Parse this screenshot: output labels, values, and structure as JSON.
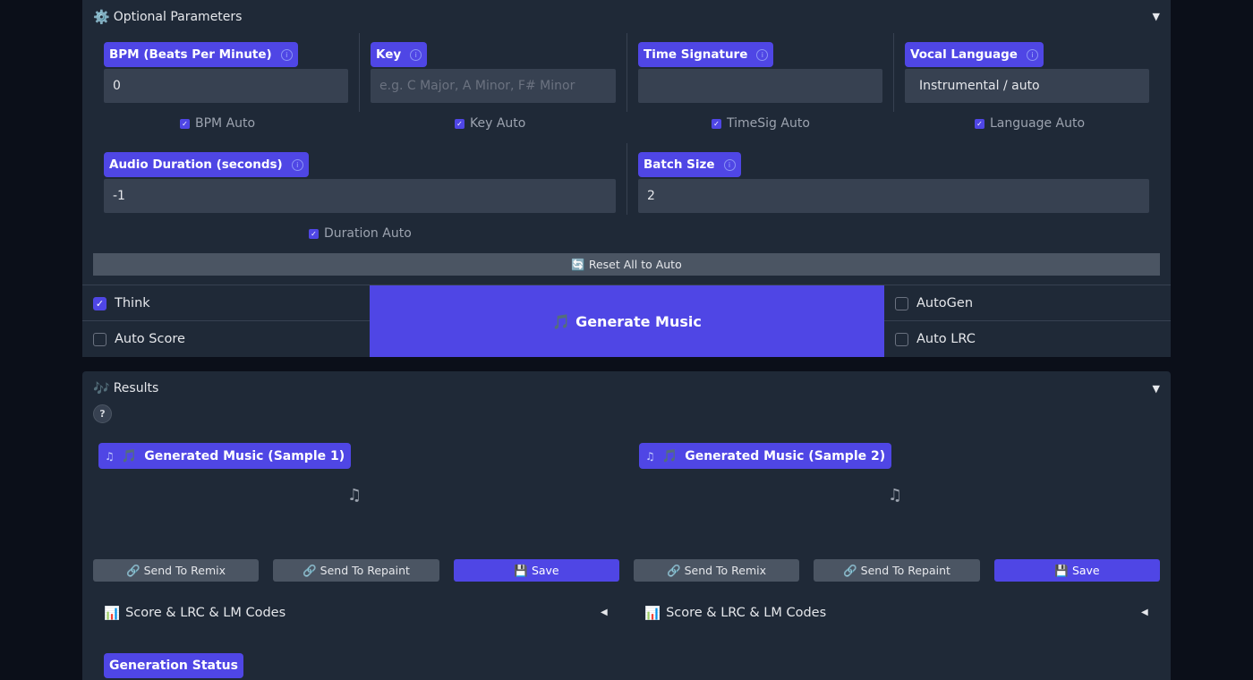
{
  "optional_parameters": {
    "title": "Optional Parameters",
    "icon": "gear-icon",
    "caret": "▼",
    "bpm": {
      "label": "BPM (Beats Per Minute)",
      "value": "0",
      "auto_label": "BPM Auto"
    },
    "key": {
      "label": "Key",
      "value": "",
      "placeholder": "e.g. C Major, A Minor, F# Minor",
      "auto_label": "Key Auto"
    },
    "time_signature": {
      "label": "Time Signature",
      "value": "",
      "auto_label": "TimeSig Auto"
    },
    "vocal_language": {
      "label": "Vocal Language",
      "value": "Instrumental / auto",
      "auto_label": "Language Auto"
    },
    "audio_duration": {
      "label": "Audio Duration (seconds)",
      "value": "-1",
      "auto_label": "Duration Auto"
    },
    "batch_size": {
      "label": "Batch Size",
      "value": "2"
    },
    "reset_label": "Reset All to Auto"
  },
  "controls": {
    "think_label": "Think",
    "auto_score_label": "Auto Score",
    "generate_label": "Generate Music",
    "autogen_label": "AutoGen",
    "auto_lrc_label": "Auto LRC"
  },
  "results": {
    "title": "Results",
    "caret": "▼",
    "help": "?",
    "samples": [
      {
        "label": "Generated Music (Sample 1)",
        "remix": "Send To Remix",
        "repaint": "Send To Repaint",
        "save": "Save",
        "score": "Score & LRC & LM Codes"
      },
      {
        "label": "Generated Music (Sample 2)",
        "remix": "Send To Remix",
        "repaint": "Send To Repaint",
        "save": "Save",
        "score": "Score & LRC & LM Codes"
      }
    ],
    "status_label": "Generation Status"
  },
  "colors": {
    "accent": "#4f46e5",
    "panel": "#1f2937",
    "background": "#0b0f19",
    "input": "#374151",
    "secondary_button": "#4b5563"
  }
}
